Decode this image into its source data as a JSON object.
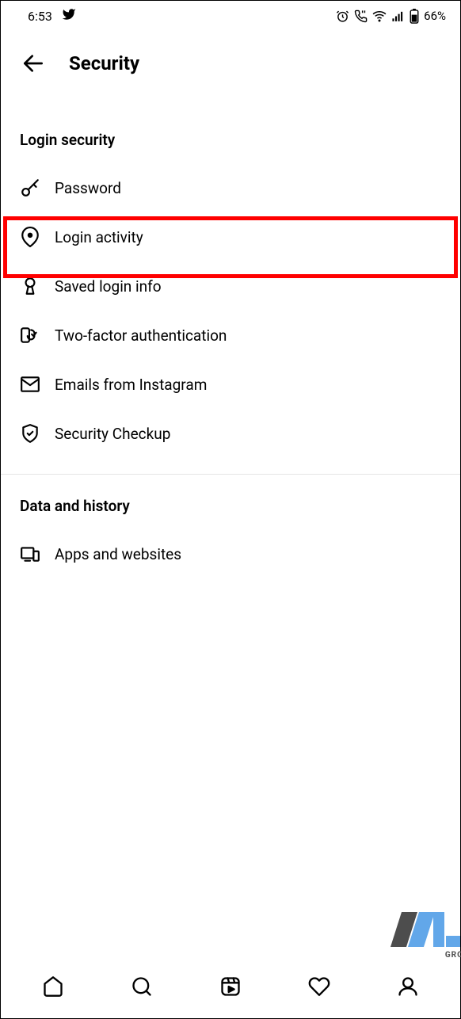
{
  "status": {
    "time": "6:53",
    "battery": "66%"
  },
  "header": {
    "title": "Security"
  },
  "sections": {
    "login": {
      "title": "Login security",
      "items": [
        {
          "label": "Password"
        },
        {
          "label": "Login activity"
        },
        {
          "label": "Saved login info"
        },
        {
          "label": "Two-factor authentication"
        },
        {
          "label": "Emails from Instagram"
        },
        {
          "label": "Security Checkup"
        }
      ]
    },
    "data": {
      "title": "Data and history",
      "items": [
        {
          "label": "Apps and websites"
        }
      ]
    }
  },
  "watermark": "GRO"
}
